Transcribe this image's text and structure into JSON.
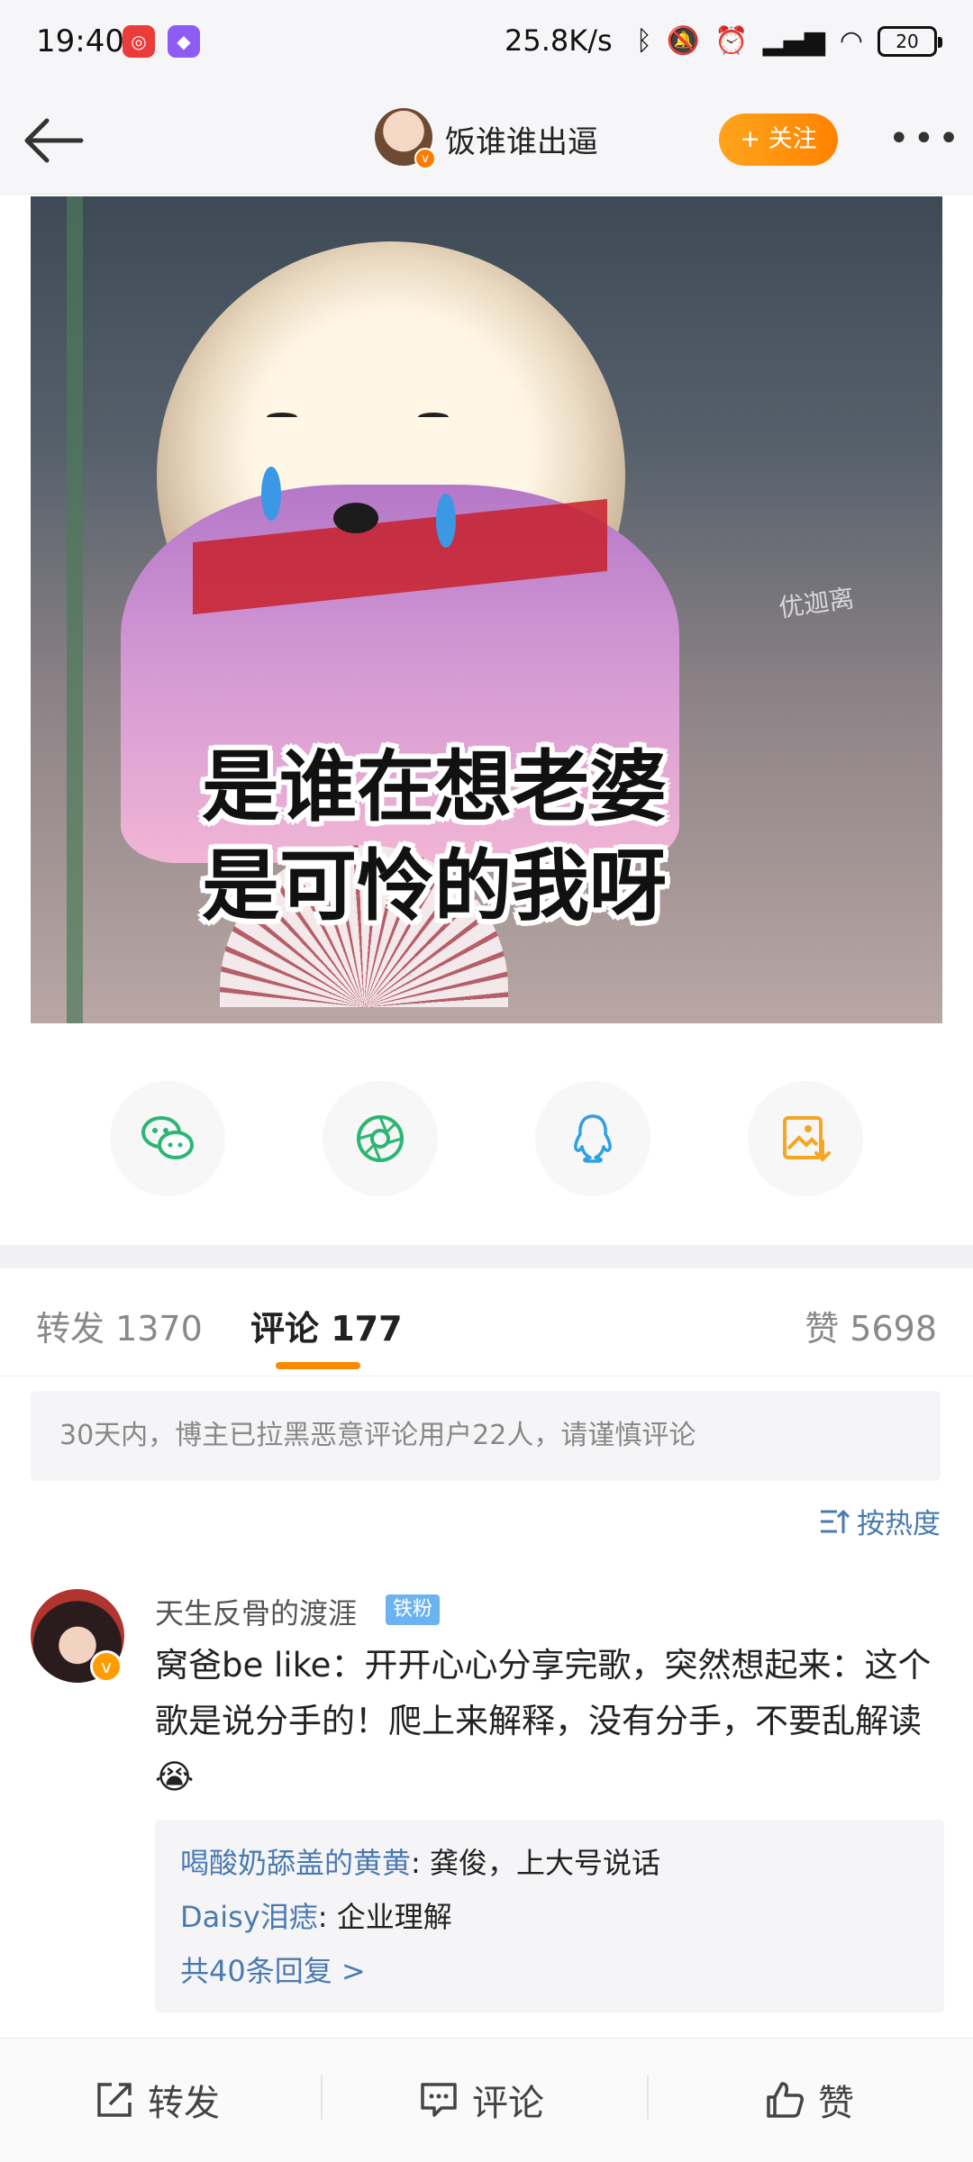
{
  "status_bar": {
    "time": "19:40",
    "net_speed": "25.8K/s",
    "battery": "20",
    "icons": [
      "bluetooth-icon",
      "mute-icon",
      "alarm-icon",
      "signal-icon",
      "wifi-icon"
    ]
  },
  "header": {
    "username": "饭谁谁出逼",
    "follow_label": "+ 关注"
  },
  "post_image": {
    "caption_line1": "是谁在想老婆",
    "caption_line2": "是可怜的我呀",
    "watermark": "优迦离"
  },
  "share_targets": [
    "wechat-icon",
    "moments-icon",
    "qq-icon",
    "save-image-icon"
  ],
  "tabs": {
    "repost": "转发 1370",
    "comment": "评论 177",
    "like": "赞 5698"
  },
  "notice": "30天内，博主已拉黑恶意评论用户22人，请谨慎评论",
  "sort_label": "按热度",
  "comment": {
    "author": "天生反骨的渡涯",
    "badge": "铁粉",
    "text": "窝爸be like：开开心心分享完歌，突然想起来：这个歌是说分手的！爬上来解释，没有分手，不要乱解读😭",
    "replies": [
      {
        "user": "喝酸奶舔盖的黄黄",
        "text": ": 龚俊，上大号说话"
      },
      {
        "user": "Daisy泪痣",
        "text": ": 企业理解"
      }
    ],
    "more_replies": "共40条回复 >"
  },
  "bottom_bar": {
    "repost": "转发",
    "comment": "评论",
    "like": "赞"
  },
  "colors": {
    "accent_orange": "#ff8a00",
    "link_blue": "#4a7ab0"
  }
}
